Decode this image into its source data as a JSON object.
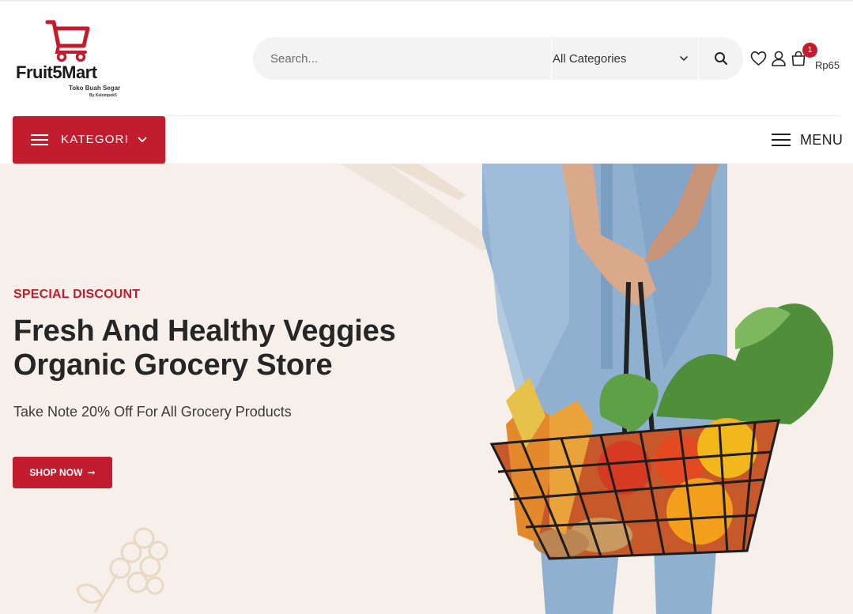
{
  "header": {
    "logo": {
      "brand": "Fruit5Mart",
      "tagline": "Toko Buah Segar",
      "byline": "By Kelompok5",
      "color": "#c21d2f"
    },
    "search": {
      "placeholder": "Search...",
      "category": "All Categories",
      "search_icon": "search-icon"
    },
    "icons": {
      "wishlist": "heart-icon",
      "account": "user-icon",
      "cart": "shopping-bag-icon",
      "cart_count": "1",
      "cart_total": "Rp65"
    }
  },
  "nav": {
    "kategori_label": "KATEGORI",
    "menu_label": "MENU"
  },
  "hero": {
    "eyebrow": "SPECIAL DISCOUNT",
    "title_line1": "Fresh And Healthy Veggies",
    "title_line2": "Organic Grocery Store",
    "subtitle": "Take Note 20% Off For All Grocery Products",
    "cta_label": "SHOP NOW",
    "cta_icon": "arrow-right-icon",
    "image": "woman holding basket of vegetables"
  },
  "colors": {
    "accent": "#c21d2f",
    "hero_bg": "#f7efe9",
    "search_bg": "#f3f3f3"
  }
}
